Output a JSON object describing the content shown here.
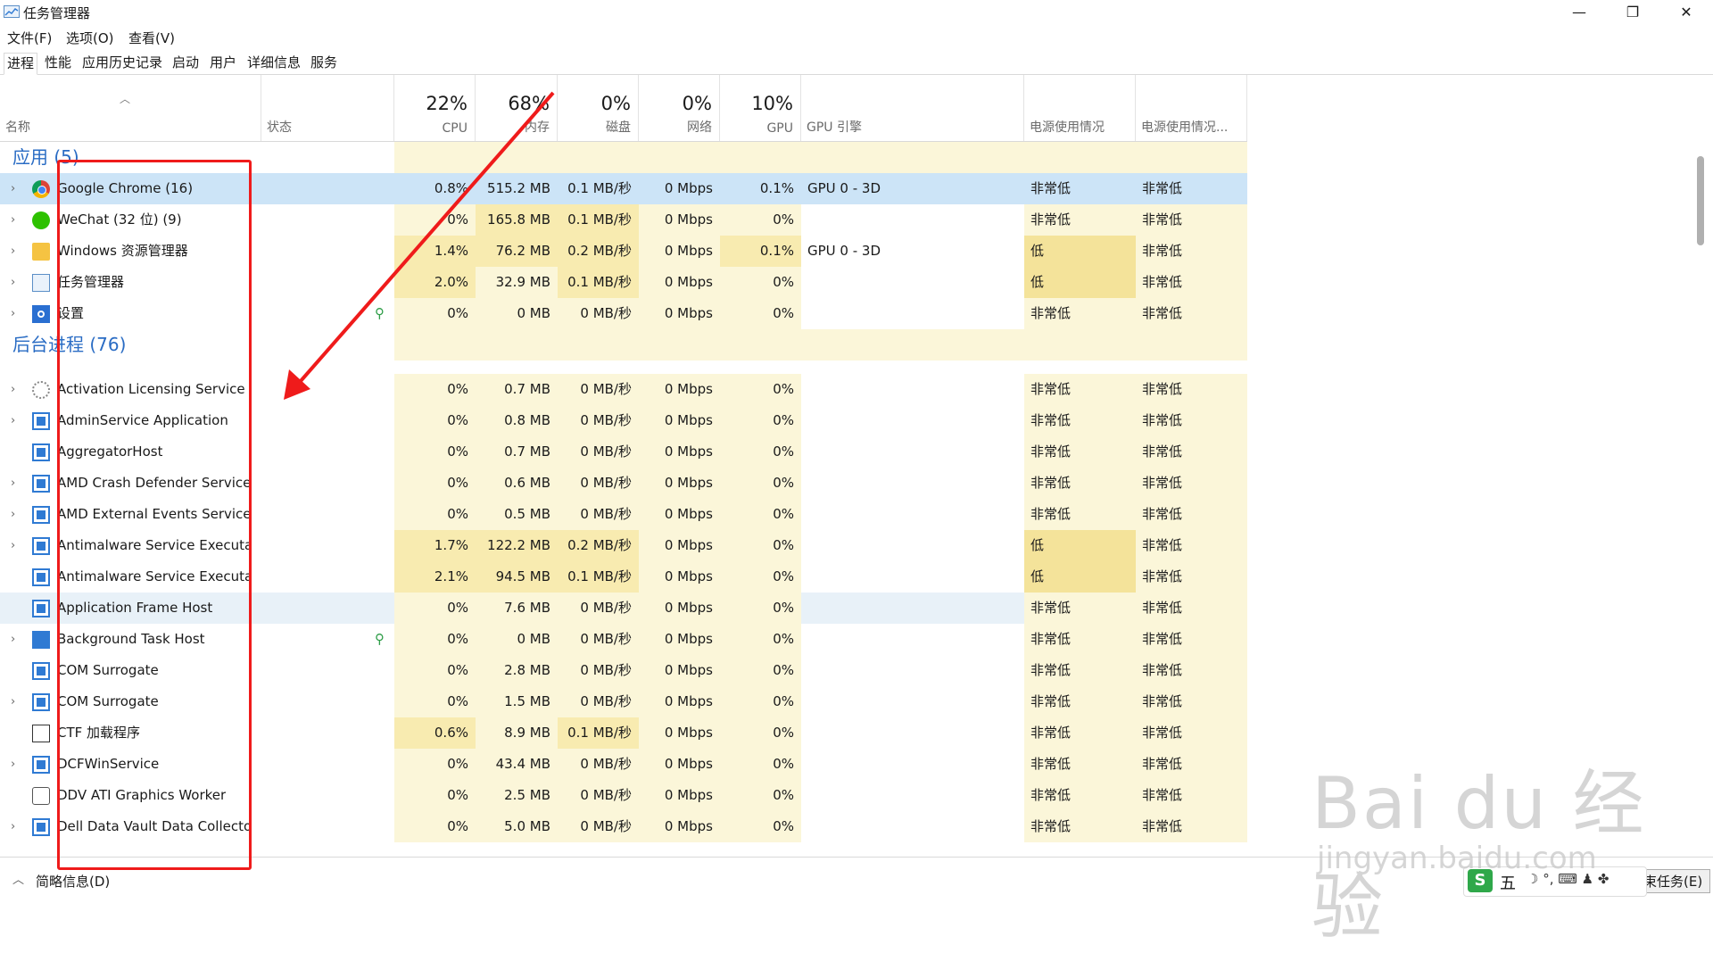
{
  "window": {
    "title": "任务管理器",
    "controls": {
      "minimize": "—",
      "restore": "❐",
      "close": "✕"
    }
  },
  "menu": [
    "文件(F)",
    "选项(O)",
    "查看(V)"
  ],
  "tabs": [
    "进程",
    "性能",
    "应用历史记录",
    "启动",
    "用户",
    "详细信息",
    "服务"
  ],
  "columns": {
    "name": "名称",
    "status": "状态",
    "cpu": {
      "pct": "22%",
      "label": "CPU"
    },
    "mem": {
      "pct": "68%",
      "label": "内存"
    },
    "disk": {
      "pct": "0%",
      "label": "磁盘"
    },
    "net": {
      "pct": "0%",
      "label": "网络"
    },
    "gpu": {
      "pct": "10%",
      "label": "GPU"
    },
    "gpu_engine": "GPU 引擎",
    "power": "电源使用情况",
    "power_trend": "电源使用情况..."
  },
  "sections": {
    "apps": "应用 (5)",
    "background": "后台进程 (76)"
  },
  "apps": [
    {
      "name": "Google Chrome (16)",
      "cpu": "0.8%",
      "mem": "515.2 MB",
      "disk": "0.1 MB/秒",
      "net": "0 Mbps",
      "gpu": "0.1%",
      "engine": "GPU 0 - 3D",
      "power": "非常低",
      "trend": "非常低",
      "icon": "chrome-icon",
      "expand": true
    },
    {
      "name": "WeChat (32 位) (9)",
      "cpu": "0%",
      "mem": "165.8 MB",
      "disk": "0.1 MB/秒",
      "net": "0 Mbps",
      "gpu": "0%",
      "engine": "",
      "power": "非常低",
      "trend": "非常低",
      "icon": "wechat-icon",
      "expand": true
    },
    {
      "name": "Windows 资源管理器",
      "cpu": "1.4%",
      "mem": "76.2 MB",
      "disk": "0.2 MB/秒",
      "net": "0 Mbps",
      "gpu": "0.1%",
      "engine": "GPU 0 - 3D",
      "power": "低",
      "trend": "非常低",
      "icon": "folder-icon",
      "expand": true
    },
    {
      "name": "任务管理器",
      "cpu": "2.0%",
      "mem": "32.9 MB",
      "disk": "0.1 MB/秒",
      "net": "0 Mbps",
      "gpu": "0%",
      "engine": "",
      "power": "低",
      "trend": "非常低",
      "icon": "task-manager-icon",
      "expand": true
    },
    {
      "name": "设置",
      "cpu": "0%",
      "mem": "0 MB",
      "disk": "0 MB/秒",
      "net": "0 Mbps",
      "gpu": "0%",
      "engine": "",
      "power": "非常低",
      "trend": "非常低",
      "icon": "settings-icon",
      "expand": true,
      "suspended": true
    }
  ],
  "background": [
    {
      "name": "Activation Licensing Service ...",
      "cpu": "0%",
      "mem": "0.7 MB",
      "disk": "0 MB/秒",
      "net": "0 Mbps",
      "gpu": "0%",
      "power": "非常低",
      "trend": "非常低",
      "icon": "license-icon",
      "expand": true
    },
    {
      "name": "AdminService Application",
      "cpu": "0%",
      "mem": "0.8 MB",
      "disk": "0 MB/秒",
      "net": "0 Mbps",
      "gpu": "0%",
      "power": "非常低",
      "trend": "非常低",
      "icon": "app-window-icon",
      "expand": true
    },
    {
      "name": "AggregatorHost",
      "cpu": "0%",
      "mem": "0.7 MB",
      "disk": "0 MB/秒",
      "net": "0 Mbps",
      "gpu": "0%",
      "power": "非常低",
      "trend": "非常低",
      "icon": "app-window-icon",
      "expand": false
    },
    {
      "name": "AMD Crash Defender Service",
      "cpu": "0%",
      "mem": "0.6 MB",
      "disk": "0 MB/秒",
      "net": "0 Mbps",
      "gpu": "0%",
      "power": "非常低",
      "trend": "非常低",
      "icon": "app-window-icon",
      "expand": true
    },
    {
      "name": "AMD External Events Service...",
      "cpu": "0%",
      "mem": "0.5 MB",
      "disk": "0 MB/秒",
      "net": "0 Mbps",
      "gpu": "0%",
      "power": "非常低",
      "trend": "非常低",
      "icon": "app-window-icon",
      "expand": true
    },
    {
      "name": "Antimalware Service Executa...",
      "cpu": "1.7%",
      "mem": "122.2 MB",
      "disk": "0.2 MB/秒",
      "net": "0 Mbps",
      "gpu": "0%",
      "power": "低",
      "trend": "非常低",
      "icon": "app-window-icon",
      "expand": true
    },
    {
      "name": "Antimalware Service Executa...",
      "cpu": "2.1%",
      "mem": "94.5 MB",
      "disk": "0.1 MB/秒",
      "net": "0 Mbps",
      "gpu": "0%",
      "power": "低",
      "trend": "非常低",
      "icon": "app-window-icon",
      "expand": false
    },
    {
      "name": "Application Frame Host",
      "cpu": "0%",
      "mem": "7.6 MB",
      "disk": "0 MB/秒",
      "net": "0 Mbps",
      "gpu": "0%",
      "power": "非常低",
      "trend": "非常低",
      "icon": "app-window-icon",
      "expand": false,
      "hover": true
    },
    {
      "name": "Background Task Host",
      "cpu": "0%",
      "mem": "0 MB",
      "disk": "0 MB/秒",
      "net": "0 Mbps",
      "gpu": "0%",
      "power": "非常低",
      "trend": "非常低",
      "icon": "task-host-icon",
      "expand": true,
      "suspended": true
    },
    {
      "name": "COM Surrogate",
      "cpu": "0%",
      "mem": "2.8 MB",
      "disk": "0 MB/秒",
      "net": "0 Mbps",
      "gpu": "0%",
      "power": "非常低",
      "trend": "非常低",
      "icon": "app-window-icon",
      "expand": false
    },
    {
      "name": "COM Surrogate",
      "cpu": "0%",
      "mem": "1.5 MB",
      "disk": "0 MB/秒",
      "net": "0 Mbps",
      "gpu": "0%",
      "power": "非常低",
      "trend": "非常低",
      "icon": "app-window-icon",
      "expand": true
    },
    {
      "name": "CTF 加载程序",
      "cpu": "0.6%",
      "mem": "8.9 MB",
      "disk": "0.1 MB/秒",
      "net": "0 Mbps",
      "gpu": "0%",
      "power": "非常低",
      "trend": "非常低",
      "icon": "ctf-loader-icon",
      "expand": false
    },
    {
      "name": "DCFWinService",
      "cpu": "0%",
      "mem": "43.4 MB",
      "disk": "0 MB/秒",
      "net": "0 Mbps",
      "gpu": "0%",
      "power": "非常低",
      "trend": "非常低",
      "icon": "app-window-icon",
      "expand": true
    },
    {
      "name": "DDV ATI Graphics Worker",
      "cpu": "0%",
      "mem": "2.5 MB",
      "disk": "0 MB/秒",
      "net": "0 Mbps",
      "gpu": "0%",
      "power": "非常低",
      "trend": "非常低",
      "icon": "robot-icon",
      "expand": false
    },
    {
      "name": "Dell Data Vault Data Collecto...",
      "cpu": "0%",
      "mem": "5.0 MB",
      "disk": "0 MB/秒",
      "net": "0 Mbps",
      "gpu": "0%",
      "power": "非常低",
      "trend": "非常低",
      "icon": "app-window-icon",
      "expand": true
    }
  ],
  "footer": {
    "brief": "简略信息(D)",
    "end_task": "结束任务(E)"
  },
  "ime": {
    "logo": "S",
    "mode": "五",
    "symbols": "☽ °, ⌨ ♟ ✤"
  },
  "watermark": {
    "brand": "Bai du 经验",
    "url": "jingyan.baidu.com"
  }
}
